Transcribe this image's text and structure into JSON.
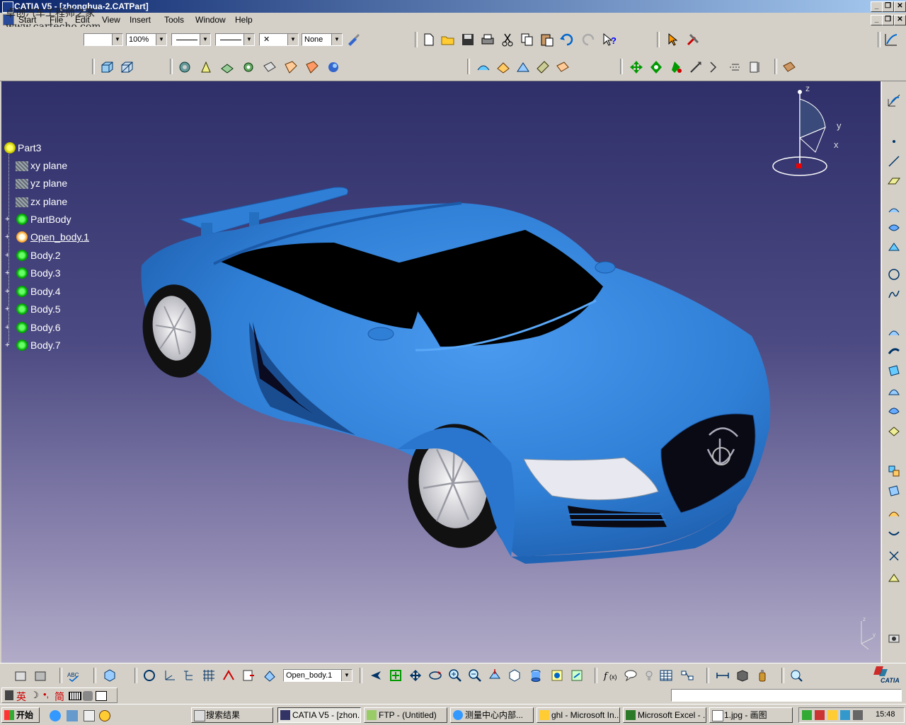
{
  "window": {
    "title": "CATIA V5 - [zhonghua-2.CATPart]"
  },
  "watermark": {
    "line1": "卓创汽车工程师之家",
    "line2": "www.cartecho.com"
  },
  "menu": [
    "Start",
    "File",
    "Edit",
    "View",
    "Insert",
    "Tools",
    "Window",
    "Help"
  ],
  "toolbar": {
    "zoom": "100%",
    "color_select": "None"
  },
  "tree": {
    "root": "Part3",
    "items": [
      "xy plane",
      "yz plane",
      "zx plane",
      "PartBody",
      "Open_body.1",
      "Body.2",
      "Body.3",
      "Body.4",
      "Body.5",
      "Body.6",
      "Body.7"
    ]
  },
  "compass": {
    "z": "z",
    "y": "y",
    "x": "x"
  },
  "bottom": {
    "current_body": "Open_body.1",
    "brand": "CATIA"
  },
  "status": {
    "ime": "英",
    "jian": "简"
  },
  "taskbar": {
    "start": "开始",
    "buttons": [
      "搜索结果",
      "CATIA V5 - [zhon...",
      "FTP - (Untitled)",
      "测量中心内部...",
      "ghl - Microsoft In...",
      "Microsoft Excel - ...",
      "1.jpg - 画图"
    ],
    "clock": "15:48"
  },
  "colors": {
    "car_body": "#2f7fd6",
    "viewport_top": "#2f2f6a",
    "viewport_bottom": "#b2acc8"
  }
}
